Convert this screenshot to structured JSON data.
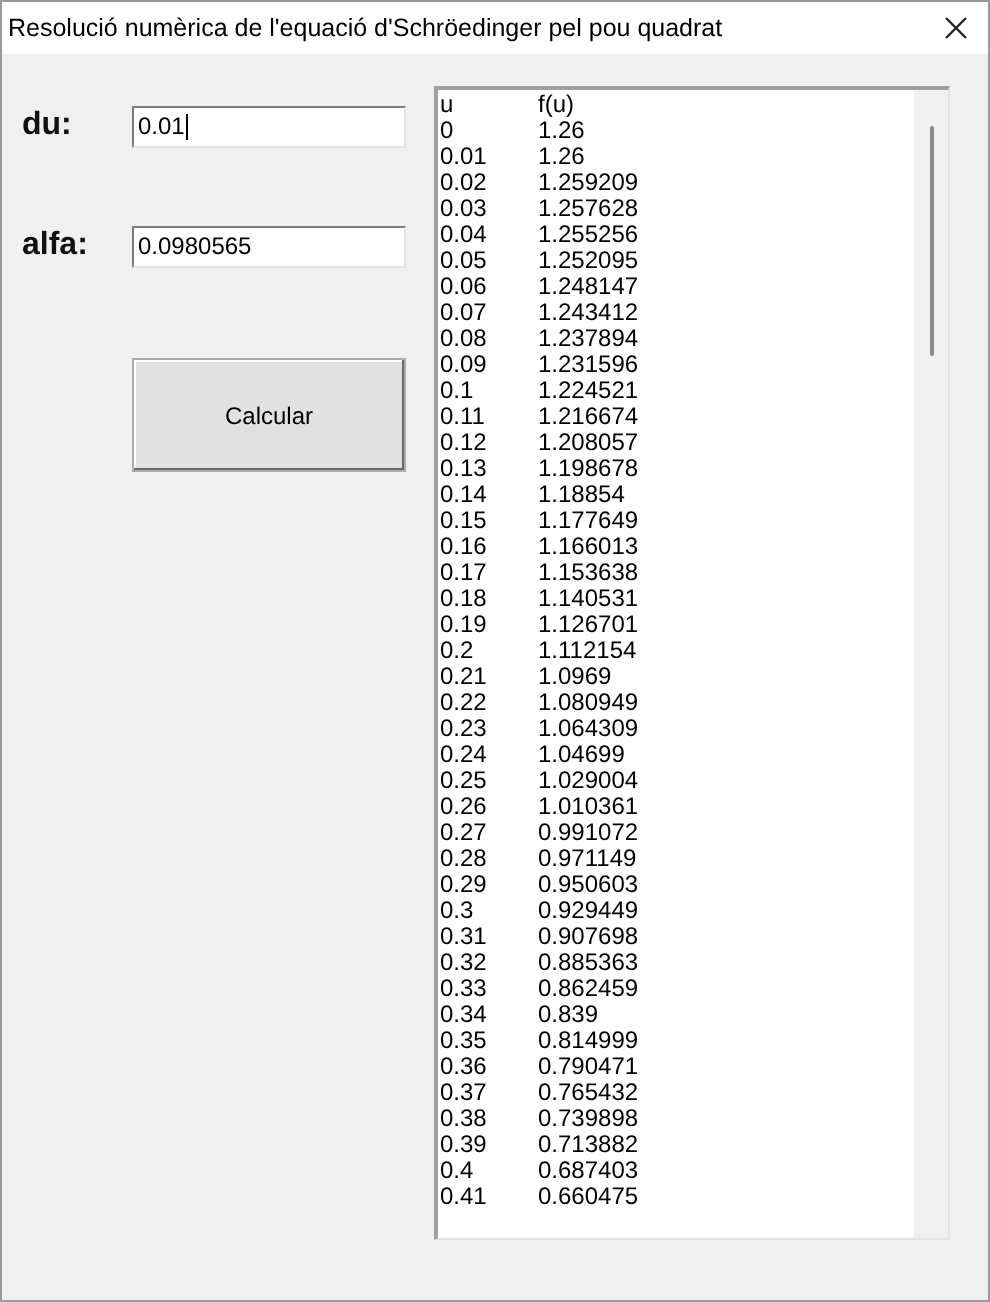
{
  "window": {
    "title": "Resolució numèrica de l'equació d'Schröedinger pel pou quadrat"
  },
  "fields": [
    {
      "label": "du:",
      "value": "0.01",
      "focused": true
    },
    {
      "label": "alfa:",
      "value": "0.0980565",
      "focused": false
    }
  ],
  "button": {
    "label": "Calcular"
  },
  "list": {
    "columns": [
      "u",
      "f(u)"
    ],
    "rows": [
      [
        "0",
        "1.26"
      ],
      [
        "0.01",
        "1.26"
      ],
      [
        "0.02",
        "1.259209"
      ],
      [
        "0.03",
        "1.257628"
      ],
      [
        "0.04",
        "1.255256"
      ],
      [
        "0.05",
        "1.252095"
      ],
      [
        "0.06",
        "1.248147"
      ],
      [
        "0.07",
        "1.243412"
      ],
      [
        "0.08",
        "1.237894"
      ],
      [
        "0.09",
        "1.231596"
      ],
      [
        "0.1",
        "1.224521"
      ],
      [
        "0.11",
        "1.216674"
      ],
      [
        "0.12",
        "1.208057"
      ],
      [
        "0.13",
        "1.198678"
      ],
      [
        "0.14",
        "1.18854"
      ],
      [
        "0.15",
        "1.177649"
      ],
      [
        "0.16",
        "1.166013"
      ],
      [
        "0.17",
        "1.153638"
      ],
      [
        "0.18",
        "1.140531"
      ],
      [
        "0.19",
        "1.126701"
      ],
      [
        "0.2",
        "1.112154"
      ],
      [
        "0.21",
        "1.0969"
      ],
      [
        "0.22",
        "1.080949"
      ],
      [
        "0.23",
        "1.064309"
      ],
      [
        "0.24",
        "1.04699"
      ],
      [
        "0.25",
        "1.029004"
      ],
      [
        "0.26",
        "1.010361"
      ],
      [
        "0.27",
        "0.991072"
      ],
      [
        "0.28",
        "0.971149"
      ],
      [
        "0.29",
        "0.950603"
      ],
      [
        "0.3",
        "0.929449"
      ],
      [
        "0.31",
        "0.907698"
      ],
      [
        "0.32",
        "0.885363"
      ],
      [
        "0.33",
        "0.862459"
      ],
      [
        "0.34",
        "0.839"
      ],
      [
        "0.35",
        "0.814999"
      ],
      [
        "0.36",
        "0.790471"
      ],
      [
        "0.37",
        "0.765432"
      ],
      [
        "0.38",
        "0.739898"
      ],
      [
        "0.39",
        "0.713882"
      ],
      [
        "0.4",
        "0.687403"
      ],
      [
        "0.41",
        "0.660475"
      ]
    ]
  }
}
